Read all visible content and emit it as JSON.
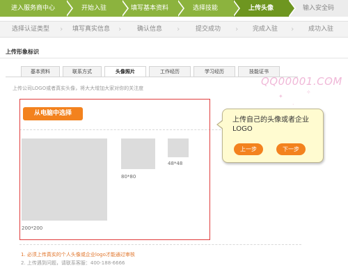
{
  "steps_top": [
    {
      "label": "进入服务商中心",
      "state": "done"
    },
    {
      "label": "开始入驻",
      "state": "done"
    },
    {
      "label": "填写基本资料",
      "state": "done"
    },
    {
      "label": "选择技能",
      "state": "done"
    },
    {
      "label": "上传头像",
      "state": "active"
    },
    {
      "label": "输入安全码",
      "state": "todo"
    }
  ],
  "steps_sub": [
    "选择认证类型",
    "填写真实信息",
    "确认信息",
    "提交成功",
    "完成入驻",
    "成功入驻"
  ],
  "section_title": "上传形象标识",
  "tabs": [
    {
      "label": "基本资料",
      "active": false
    },
    {
      "label": "联系方式",
      "active": false
    },
    {
      "label": "头像照片",
      "active": true
    },
    {
      "label": "工作经历",
      "active": false
    },
    {
      "label": "学习经历",
      "active": false
    },
    {
      "label": "技能证书",
      "active": false
    }
  ],
  "hint": "上传公司LOGO或者真实头像，将大大增加大家对你的关注度",
  "watermark": "QQ00001.COM",
  "pick_button": "从电脑中选择",
  "previews": {
    "large": "200*200",
    "medium": "80*80",
    "small": "48*48"
  },
  "tooltip": {
    "text": "上传自己的头像或者企业LOGO",
    "prev": "上一步",
    "next": "下一步"
  },
  "notes": [
    "1. 必须上传真实的个人头像或企业logo才能通过审核",
    "2. 上传遇到问题，请联系客服：400-188-6666"
  ],
  "colors": {
    "green": "#8cb33e",
    "active_green": "#6e9620",
    "orange": "#f3821e",
    "frame_red": "#e03a3a"
  }
}
